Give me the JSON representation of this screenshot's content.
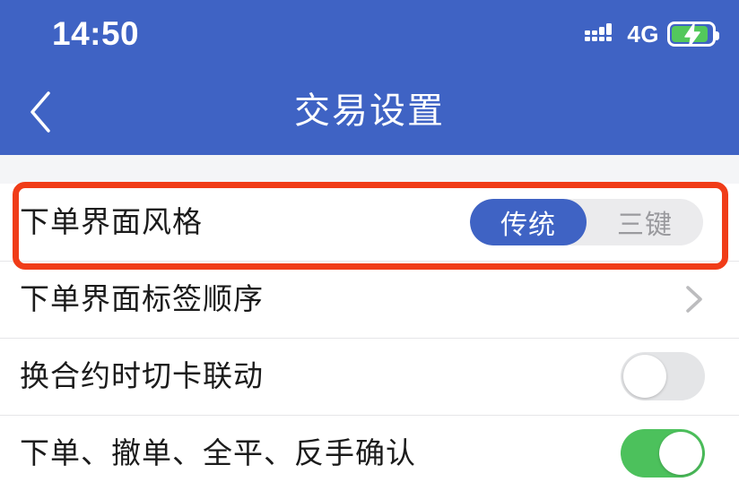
{
  "status_bar": {
    "time": "14:50",
    "network_label": "4G",
    "signal_icon": "signal-bars-icon",
    "battery_icon": "battery-charging-icon"
  },
  "nav_bar": {
    "back_icon": "chevron-left-icon",
    "title": "交易设置"
  },
  "colors": {
    "header_blue": "#3f63c4",
    "accent_blue": "#3f63c4",
    "toggle_on_green": "#4cc15c",
    "toggle_off_gray": "#e4e5e7",
    "annotation_red": "#f03c18",
    "band_gray": "#f4f5f7"
  },
  "settings": {
    "rows": [
      {
        "label": "下单界面风格",
        "control": "segmented",
        "options": [
          "传统",
          "三键"
        ],
        "selected": "传统"
      },
      {
        "label": "下单界面标签顺序",
        "control": "disclosure",
        "icon": "chevron-right-icon"
      },
      {
        "label": "换合约时切卡联动",
        "control": "toggle",
        "state": "off"
      },
      {
        "label": "下单、撤单、全平、反手确认",
        "control": "toggle",
        "state": "on"
      }
    ]
  },
  "annotation": {
    "shape": "rectangle",
    "target": "下单界面风格"
  }
}
